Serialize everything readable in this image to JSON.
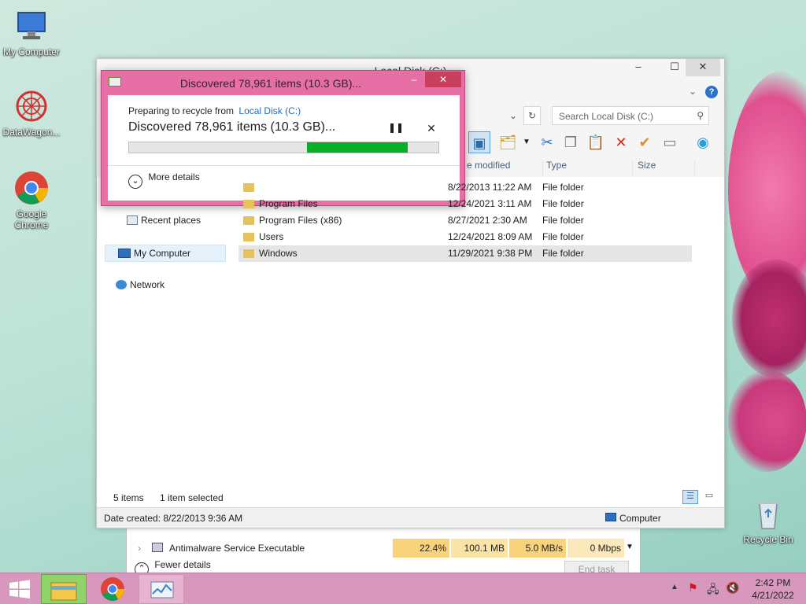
{
  "desktop": {
    "icons": [
      {
        "label": "My Computer"
      },
      {
        "label": "DataWagon..."
      },
      {
        "label": "Google Chrome"
      },
      {
        "label": "Recycle Bin"
      }
    ]
  },
  "explorer": {
    "title": "Local Disk (C:)",
    "search_placeholder": "Search Local Disk (C:)",
    "columns": {
      "modified": "e modified",
      "type": "Type",
      "size": "Size"
    },
    "rows": [
      {
        "name": "",
        "date": "8/22/2013 11:22 AM",
        "type": "File folder"
      },
      {
        "name": "Program Files",
        "date": "12/24/2021 3:11 AM",
        "type": "File folder"
      },
      {
        "name": "Program Files (x86)",
        "date": "8/27/2021 2:30 AM",
        "type": "File folder"
      },
      {
        "name": "Users",
        "date": "12/24/2021 8:09 AM",
        "type": "File folder"
      },
      {
        "name": "Windows",
        "date": "11/29/2021 9:38 PM",
        "type": "File folder"
      }
    ],
    "nav": {
      "recent": "Recent places",
      "mycomputer": "My Computer",
      "network": "Network"
    },
    "status": {
      "items": "5 items",
      "selected": "1 item selected"
    },
    "details": {
      "date_created": "Date created: 8/22/2013 9:36 AM",
      "computer": "Computer"
    }
  },
  "dialog": {
    "title": "Discovered 78,961 items (10.3 GB)...",
    "preparing": "Preparing to recycle from",
    "location": "Local Disk (C:)",
    "status": "Discovered 78,961 items (10.3 GB)...",
    "progress": 0.61,
    "more_details": "More details"
  },
  "taskmgr": {
    "process": "Antimalware Service Executable",
    "cpu": "22.4%",
    "memory": "100.1 MB",
    "disk": "5.0 MB/s",
    "network": "0 Mbps",
    "fewer_details": "Fewer details",
    "end_task": "End task"
  },
  "taskbar": {
    "time": "2:42 PM",
    "date": "4/21/2022"
  },
  "colors": {
    "accent_dialog": "#e66fa5",
    "taskbar": "#d897bd",
    "progress": "#06b025"
  }
}
